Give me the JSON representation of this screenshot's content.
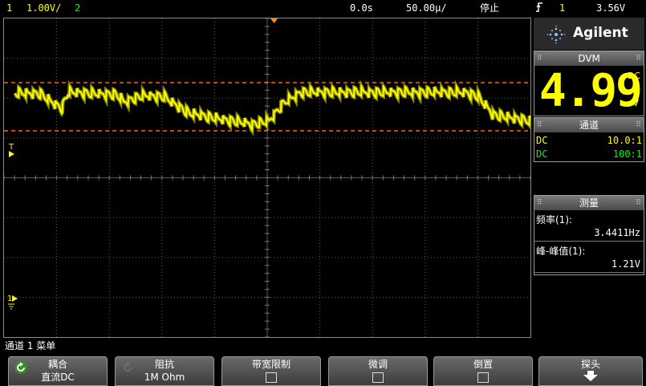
{
  "status_bar": {
    "ch1_label": "1",
    "ch1_scale": "1.00V/",
    "ch2_label": "2",
    "time_position": "0.0s",
    "time_scale": "50.00µ/",
    "run_state": "停止",
    "trigger_icon": "trigger-edge-icon",
    "trigger_source": "1",
    "trigger_level": "3.56V"
  },
  "screen": {
    "trigger_marker_label": "T",
    "ground_marker_label": "1"
  },
  "brand": {
    "name": "Agilent",
    "logo_icon": "agilent-spark-icon"
  },
  "dvm": {
    "header": "DVM",
    "reading": "4.99",
    "mode": "DC",
    "unit": "V"
  },
  "channels": {
    "header": "通道",
    "rows": [
      {
        "coupling": "DC",
        "probe": "10.0:1",
        "color": "#ffff00"
      },
      {
        "coupling": "DC",
        "probe": "100:1",
        "color": "#00ff00"
      }
    ]
  },
  "measurements": {
    "header": "测量",
    "items": [
      {
        "label": "频率(1):",
        "value": "3.4411Hz"
      },
      {
        "label": "峰-峰值(1):",
        "value": "1.21V"
      }
    ]
  },
  "menu": {
    "title": "通道 1 菜单",
    "softkeys": [
      {
        "label": "耦合",
        "value": "直流DC",
        "icon": "refresh-icon"
      },
      {
        "label": "阻抗",
        "value": "1M Ohm",
        "icon": "refresh-icon"
      },
      {
        "label": "带宽限制",
        "value": "",
        "icon": "checkbox-icon"
      },
      {
        "label": "微调",
        "value": "",
        "icon": "checkbox-icon"
      },
      {
        "label": "倒置",
        "value": "",
        "icon": "checkbox-icon"
      },
      {
        "label": "探头",
        "value": "",
        "icon": "submenu-arrow-icon"
      }
    ]
  },
  "colors": {
    "channel1": "#ffff00",
    "channel2": "#00ff00",
    "cursor": "#ff6600",
    "grid": "#5a5a5a"
  }
}
